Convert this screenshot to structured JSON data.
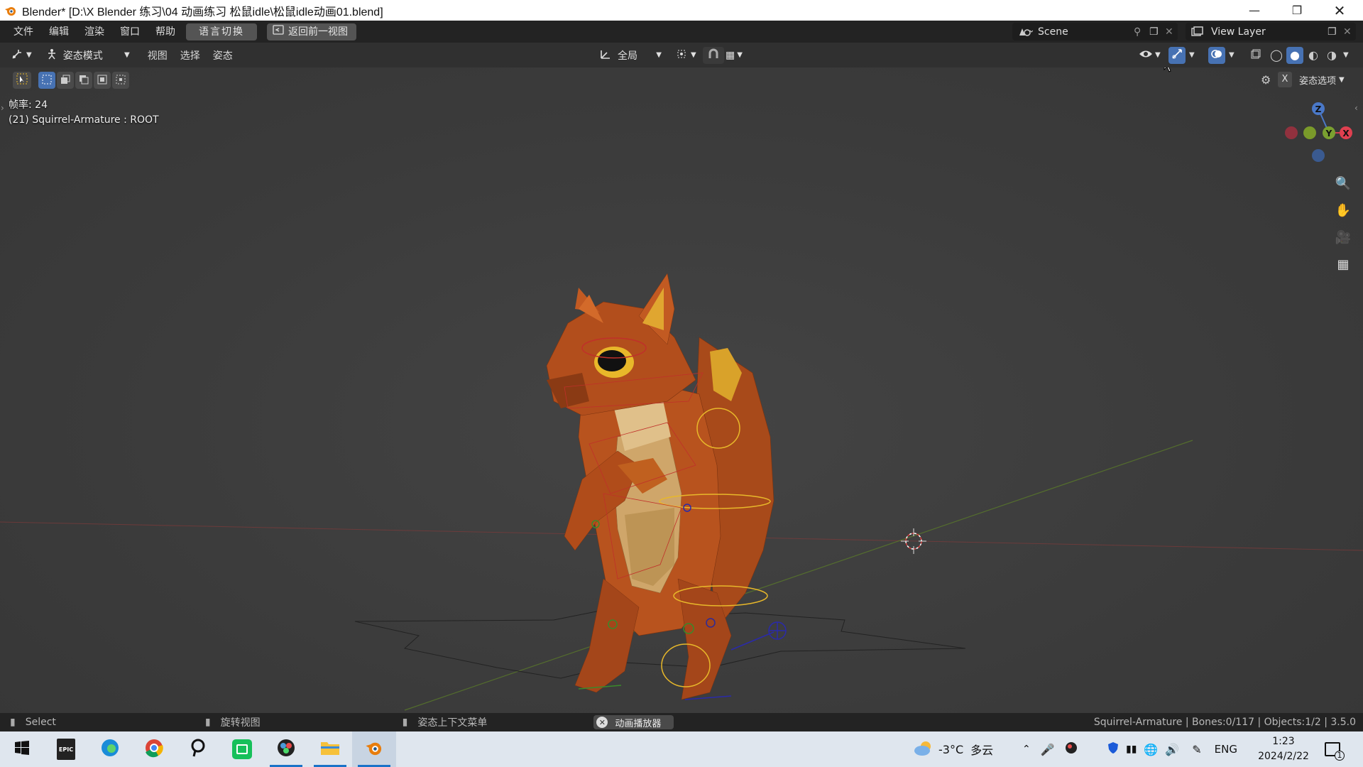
{
  "window": {
    "title": "Blender* [D:\\X Blender 练习\\04 动画练习 松鼠idle\\松鼠idle动画01.blend]",
    "minimize_icon": "minimize-icon",
    "maximize_icon": "restore-icon",
    "close_icon": "close-icon"
  },
  "topbar": {
    "menus": [
      "文件",
      "编辑",
      "渲染",
      "窗口",
      "帮助"
    ],
    "lang_button": "语言切换",
    "back_button": "返回前一视图",
    "scene": "Scene",
    "view_layer": "View Layer"
  },
  "header": {
    "mode": "姿态模式",
    "menus": [
      "视图",
      "选择",
      "姿态"
    ],
    "transform_orientation": "全局",
    "pose_options": "姿态选项"
  },
  "viewport": {
    "fps_label": "帧率: 24",
    "object_info": "(21) Squirrel-Armature : ROOT",
    "gizmo_axes": {
      "z": "Z",
      "y": "Y",
      "x": "X"
    }
  },
  "statusbar": {
    "select": "Select",
    "rotate": "旋转视图",
    "context": "姿态上下文菜单",
    "anim_player": "动画播放器",
    "stats": "Squirrel-Armature | Bones:0/117 | Objects:1/2 | 3.5.0"
  },
  "taskbar": {
    "weather_temp": "-3°C",
    "weather_desc": "多云",
    "lang": "ENG",
    "time": "1:23",
    "date": "2024/2/22",
    "notification_count": "1"
  },
  "colors": {
    "accent_blue": "#4772b3",
    "topbar_bg": "#232323",
    "header_bg": "#303030",
    "viewport_bg": "#3d3d3d",
    "squirrel_orange": "#b8531e",
    "bone_yellow": "#e8b82a"
  }
}
